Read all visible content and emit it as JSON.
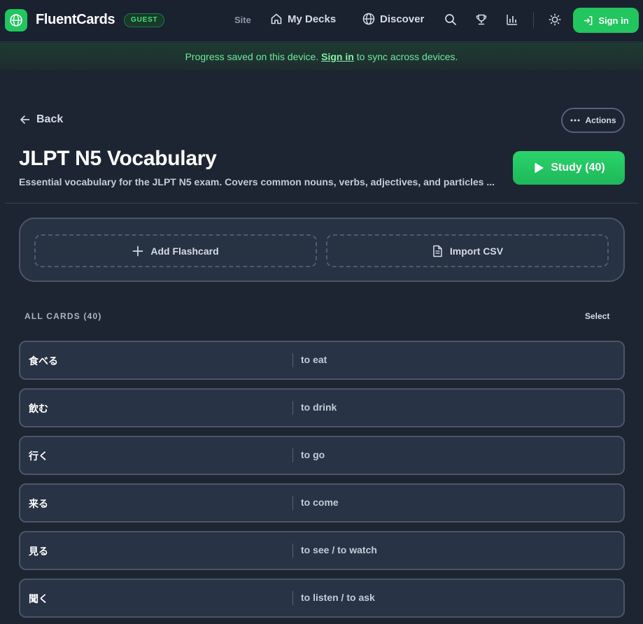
{
  "app": {
    "name": "FluentCards",
    "badge": "GUEST",
    "brand_color": "#22c55e"
  },
  "nav": {
    "site_label": "Site",
    "my_decks_label": "My Decks",
    "discover_label": "Discover",
    "sign_in_label": "Sign in"
  },
  "banner": {
    "text_before": "Progress saved on this device.",
    "link_text": "Sign in",
    "text_after": "to sync across devices."
  },
  "deck": {
    "back_label": "Back",
    "actions_label": "Actions",
    "title": "JLPT N5 Vocabulary",
    "description": "Essential vocabulary for the JLPT N5 exam. Covers common nouns, verbs, adjectives, and particles ...",
    "study_label": "Study (40)"
  },
  "toolbar": {
    "add_label": "Add Flashcard",
    "import_label": "Import CSV"
  },
  "cards": {
    "header": "ALL CARDS (40)",
    "select_label": "Select",
    "items": [
      {
        "front": "食べる",
        "back": "to eat"
      },
      {
        "front": "飲む",
        "back": "to drink"
      },
      {
        "front": "行く",
        "back": "to go"
      },
      {
        "front": "来る",
        "back": "to come"
      },
      {
        "front": "見る",
        "back": "to see / to watch"
      },
      {
        "front": "聞く",
        "back": "to listen / to ask"
      }
    ]
  }
}
